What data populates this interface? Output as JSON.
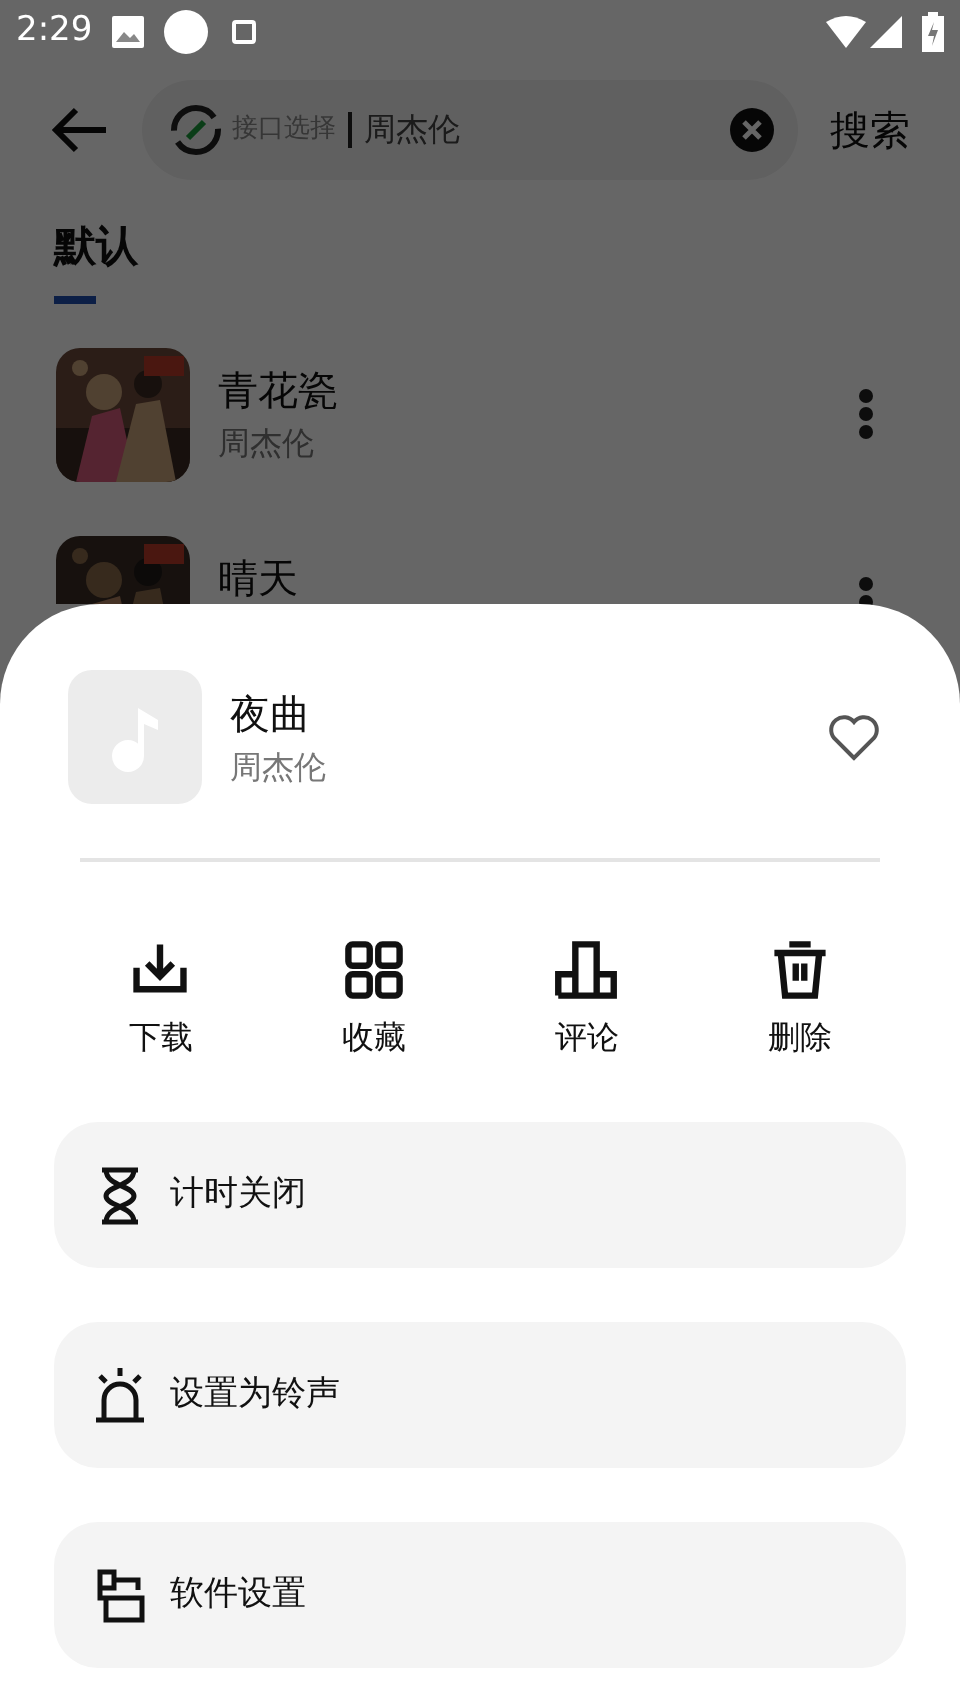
{
  "status_bar": {
    "time": "2:29"
  },
  "search": {
    "source_label": "接口选择",
    "value": "周杰伦",
    "button": "搜索"
  },
  "tabs": [
    {
      "label": "默认",
      "selected": true
    }
  ],
  "songs": [
    {
      "title": "青花瓷",
      "artist": "周杰伦"
    },
    {
      "title": "晴天"
    }
  ],
  "sheet": {
    "song": {
      "title": "夜曲",
      "artist": "周杰伦",
      "favorite": false
    },
    "actions": [
      {
        "kind": "download",
        "label": "下载"
      },
      {
        "kind": "collect",
        "label": "收藏"
      },
      {
        "kind": "comment",
        "label": "评论"
      },
      {
        "kind": "delete",
        "label": "删除"
      }
    ],
    "menu": [
      {
        "kind": "timer",
        "label": "计时关闭"
      },
      {
        "kind": "ringtone",
        "label": "设置为铃声"
      },
      {
        "kind": "settings",
        "label": "软件设置"
      }
    ]
  }
}
